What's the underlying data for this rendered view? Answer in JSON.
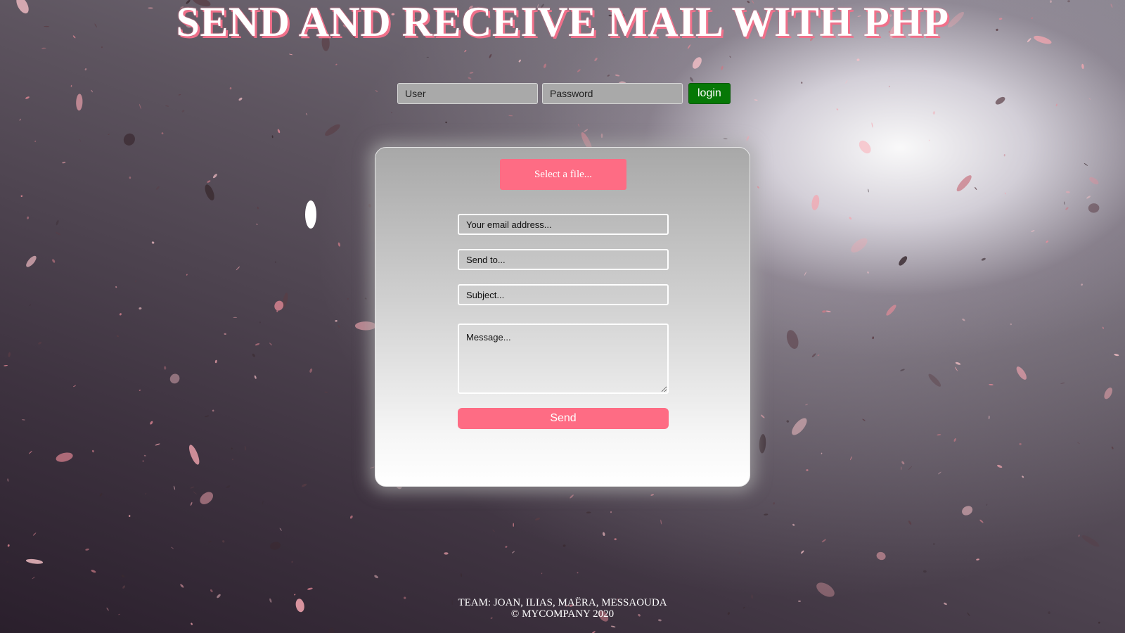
{
  "header": {
    "title": "SEND AND RECEIVE MAIL WITH PHP"
  },
  "login": {
    "user_placeholder": "User",
    "password_placeholder": "Password",
    "button_label": "login"
  },
  "form": {
    "file_button_label": "Select a file...",
    "email_placeholder": "Your email address...",
    "send_to_placeholder": "Send to...",
    "subject_placeholder": "Subject...",
    "message_placeholder": "Message...",
    "send_label": "Send"
  },
  "footer": {
    "team": "TEAM: JOAN, ILIAS, MAËRA, MESSAOUDA",
    "copyright": "© MYCOMPANY 2020"
  },
  "colors": {
    "accent_pink": "#fe6c84",
    "login_green": "#067806",
    "title_shadow": "#f0708a"
  }
}
